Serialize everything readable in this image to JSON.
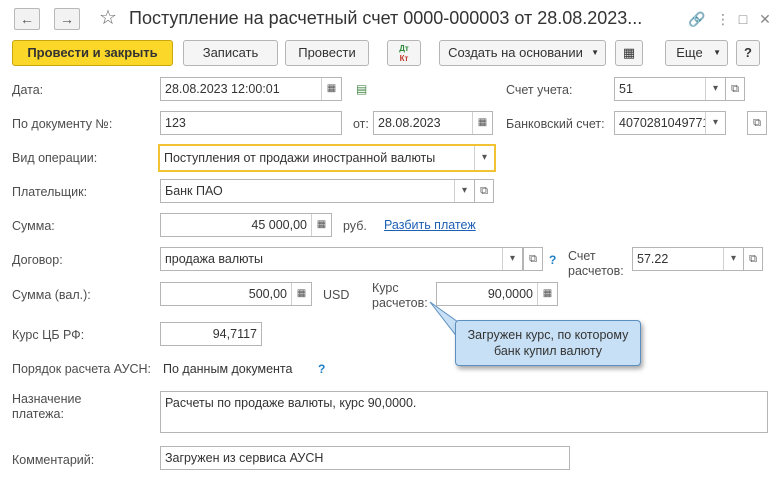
{
  "header": {
    "back_icon": "arrow-left-icon",
    "forward_icon": "arrow-right-icon",
    "title": "Поступление на расчетный счет 0000-000003 от 28.08.2023..."
  },
  "toolbar": {
    "post_close": "Провести и закрыть",
    "save": "Записать",
    "post": "Провести",
    "dt_kt_top": "Дт",
    "dt_kt_bottom": "Кт",
    "create_basis": "Создать на основании",
    "more": "Еще",
    "help": "?"
  },
  "form": {
    "date_label": "Дата:",
    "date_value": "28.08.2023 12:00:01",
    "account_label": "Счет учета:",
    "account_value": "51",
    "doc_no_label": "По документу №:",
    "doc_no_value": "123",
    "from_label": "от:",
    "from_value": "28.08.2023",
    "bank_account_label": "Банковский счет:",
    "bank_account_value": "40702810497710(",
    "op_type_label": "Вид операции:",
    "op_type_value": "Поступления от продажи иностранной валюты",
    "payer_label": "Плательщик:",
    "payer_value": "Банк ПАО",
    "sum_label": "Сумма:",
    "sum_value": "45 000,00",
    "sum_currency": "руб.",
    "split_payment": "Разбить платеж",
    "contract_label": "Договор:",
    "contract_value": "продажа валюты",
    "help_mark": "?",
    "settle_account_label1": "Счет",
    "settle_account_label2": "расчетов:",
    "settle_account_value": "57.22",
    "sum_cur_label": "Сумма (вал.):",
    "sum_cur_value": "500,00",
    "sum_cur_currency": "USD",
    "rate_label1": "Курс",
    "rate_label2": "расчетов:",
    "rate_value": "90,0000",
    "cb_rate_label": "Курс ЦБ РФ:",
    "cb_rate_value": "94,7117",
    "ausn_label": "Порядок расчета АУСН:",
    "ausn_value": "По данным документа",
    "purpose_label1": "Назначение",
    "purpose_label2": "платежа:",
    "purpose_value": "Расчеты по продаже валюты, курс 90,0000.",
    "comment_label": "Комментарий:",
    "comment_value": "Загружен из сервиса АУСН"
  },
  "tooltip": {
    "line1": "Загружен курс, по которому",
    "line2": "банк купил валюту"
  }
}
